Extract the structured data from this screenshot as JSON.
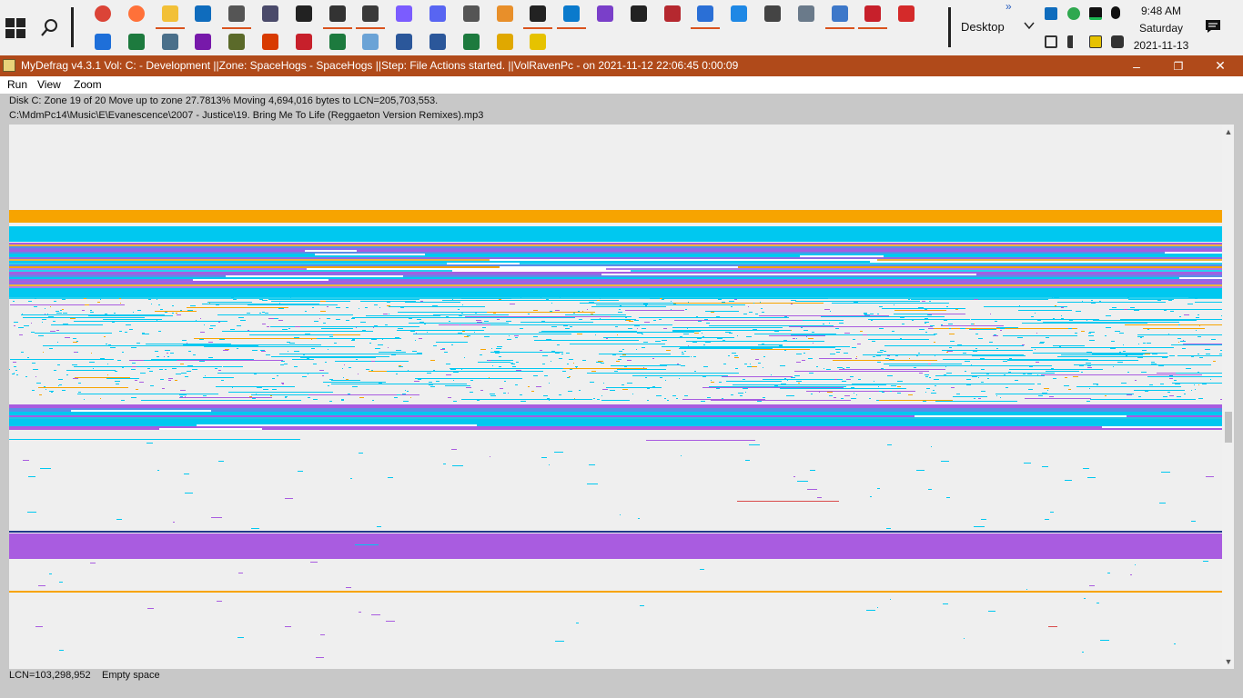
{
  "taskbar": {
    "desktop_label": "Desktop",
    "overflow_label": "»",
    "clock_time": "9:48 AM",
    "clock_day": "Saturday",
    "clock_date": "2021-11-13",
    "row1_icons": [
      "chrome-icon",
      "firefox-icon",
      "file-explorer-icon",
      "outlook-icon",
      "gimp-icon",
      "utility-icon",
      "terminal-icon",
      "printer-app-icon",
      "notepad-app-icon",
      "messenger-icon",
      "discord-icon",
      "clock-task-icon",
      "paint-app-icon",
      "console-icon",
      "vscode-icon",
      "visual-studio-icon",
      "cmd-icon",
      "mstsc-icon",
      "powershell-icon",
      "start-grid-icon",
      "settings-icon",
      "control-panel-icon",
      "remote-desktop-icon",
      "acrobat-icon",
      "pdf-app-icon"
    ],
    "row2_icons": [
      "todo-icon",
      "excel-icon",
      "display-icon",
      "onenote-icon",
      "tree-app-icon",
      "office-icon",
      "acrobat-reader-icon",
      "excel-app-icon",
      "notes-icon",
      "word-icon",
      "document-icon",
      "sheet-icon",
      "paint-doc-icon",
      "mydefrag-icon"
    ]
  },
  "window": {
    "title": "MyDefrag v4.3.1   Vol: C: - Development ||Zone: SpaceHogs - SpaceHogs ||Step: File Actions started. ||VolRavenPc -  on 2021-11-12 22:06:45 0:00:09",
    "minimize": "–",
    "restore": "❐",
    "close": "✕"
  },
  "menu": {
    "run": "Run",
    "view": "View",
    "zoom": "Zoom"
  },
  "status": {
    "line1": "Disk C:   Zone 19 of 20   Move up to zone   27.7813%   Moving 4,694,016 bytes to LCN=205,703,553.",
    "line2": "C:\\MdmPc14\\Music\\E\\Evanescence\\2007 - Justice\\19. Bring Me To Life (Reggaeton Version Remixes).mp3"
  },
  "bottom": {
    "lcn": "LCN=103,298,952",
    "info": "Empty space"
  },
  "colors": {
    "title_bar": "#b04a1a",
    "empty": "#efefef",
    "orange": "#f7a400",
    "cyan": "#00c8f0",
    "purple": "#a95ce0",
    "dark_blue": "#1f3a8a"
  }
}
